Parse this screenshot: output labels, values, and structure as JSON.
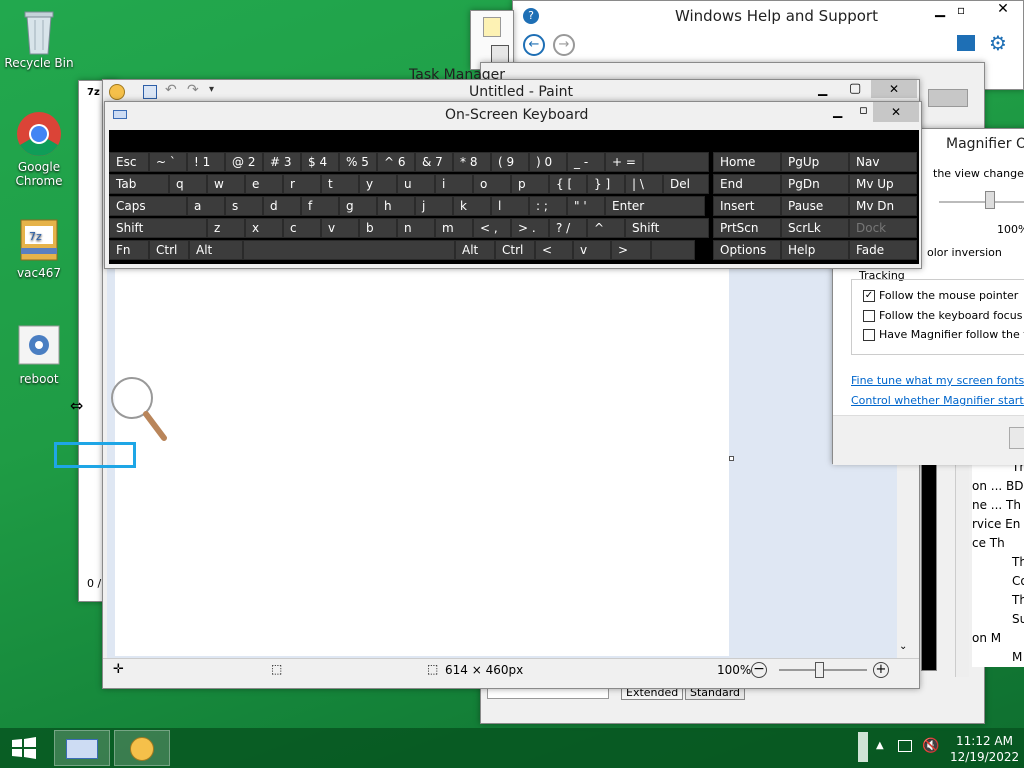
{
  "desktop": {
    "icons": [
      {
        "label": "Recycle Bin",
        "icon": "recycle-bin-icon"
      },
      {
        "label": "Google Chrome",
        "icon": "chrome-icon"
      },
      {
        "label": "vac467",
        "icon": "archive-icon"
      },
      {
        "label": "reboot",
        "icon": "gear-icon"
      }
    ]
  },
  "help_window": {
    "title": "Windows Help and Support"
  },
  "task_manager": {
    "title": "Task Manager",
    "status": "0 /",
    "tabs": [
      "Extended",
      "Standard"
    ],
    "rows": [
      "Th",
      "on ... BD",
      "ne ... Th",
      "rvice En",
      "ce Th",
      "Th",
      "Co",
      "Th",
      "Su",
      "on M",
      "M"
    ]
  },
  "paint": {
    "title": "Untitled - Paint",
    "size_label": "614 × 460px",
    "zoom": "100%"
  },
  "osk": {
    "title": "On-Screen Keyboard",
    "row1": [
      "Esc",
      "~ `",
      "! 1",
      "@ 2",
      "# 3",
      "$ 4",
      "% 5",
      "^ 6",
      "& 7",
      "* 8",
      "( 9",
      ") 0",
      "_ -",
      "+ ="
    ],
    "row2": [
      "Tab",
      "q",
      "w",
      "e",
      "r",
      "t",
      "y",
      "u",
      "i",
      "o",
      "p",
      "{ [",
      "} ]",
      "| \\",
      "Del"
    ],
    "row3": [
      "Caps",
      "a",
      "s",
      "d",
      "f",
      "g",
      "h",
      "j",
      "k",
      "l",
      ": ;",
      "\" '",
      "Enter"
    ],
    "row4": [
      "Shift",
      "z",
      "x",
      "c",
      "v",
      "b",
      "n",
      "m",
      "< ,",
      "> .",
      "? /",
      "^",
      "Shift"
    ],
    "row5": [
      "Fn",
      "Ctrl",
      "Alt",
      "Alt",
      "Ctrl",
      "<",
      "v",
      ">"
    ],
    "nav": [
      [
        "Home",
        "PgUp",
        "Nav"
      ],
      [
        "End",
        "PgDn",
        "Mv Up"
      ],
      [
        "Insert",
        "Pause",
        "Mv Dn"
      ],
      [
        "PrtScn",
        "ScrLk",
        "Dock"
      ],
      [
        "Options",
        "Help",
        "Fade"
      ]
    ]
  },
  "magnifier": {
    "title": "Magnifier O",
    "view_changes": "the view changes",
    "zoom": "100%",
    "color_inversion": "olor inversion",
    "tracking": "Tracking",
    "options": [
      {
        "label": "Follow the mouse pointer",
        "checked": true
      },
      {
        "label": "Follow the keyboard focus",
        "checked": false
      },
      {
        "label": "Have Magnifier follow the te",
        "checked": false
      }
    ],
    "link1": "Fine tune what my screen fonts lo",
    "link2": "Control whether Magnifier starts v"
  },
  "taskbar": {
    "time": "11:12 AM",
    "date": "12/19/2022"
  }
}
